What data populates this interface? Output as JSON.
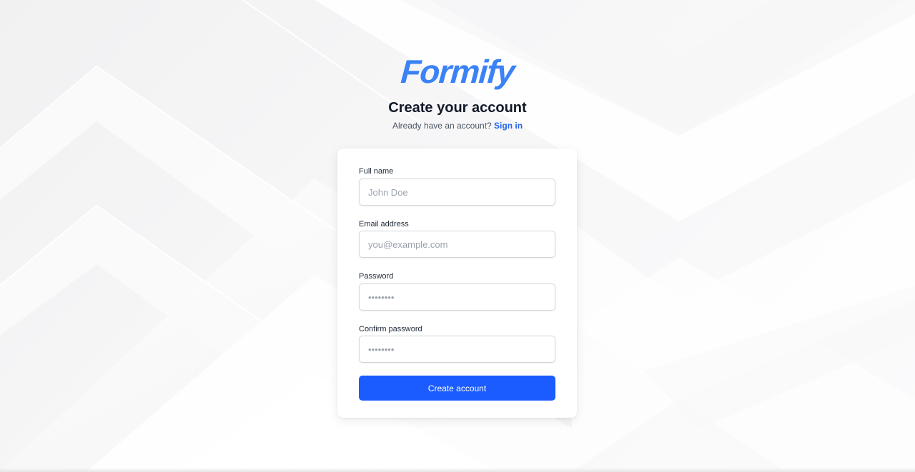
{
  "brand": {
    "logo_text": "Formify",
    "logo_color": "#3b82f6",
    "accent_color": "#1a5cff"
  },
  "header": {
    "title": "Create your account",
    "subtitle_text": "Already have an account?",
    "signin_link": "Sign in"
  },
  "form": {
    "full_name": {
      "label": "Full name",
      "placeholder": "John Doe",
      "value": ""
    },
    "email": {
      "label": "Email address",
      "placeholder": "you@example.com",
      "value": ""
    },
    "password": {
      "label": "Password",
      "placeholder": "••••••••",
      "value": ""
    },
    "confirm_password": {
      "label": "Confirm password",
      "placeholder": "••••••••",
      "value": ""
    },
    "submit_label": "Create account"
  }
}
